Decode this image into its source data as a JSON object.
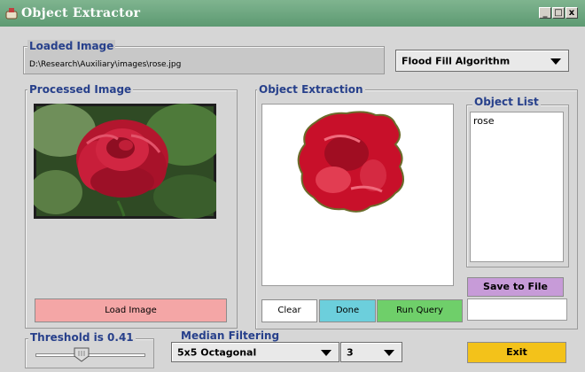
{
  "window": {
    "title": "Object Extractor",
    "controls": {
      "minimize": "_",
      "maximize": "□",
      "close": "x"
    }
  },
  "loaded_image": {
    "label": "Loaded Image",
    "path": "D:\\Research\\Auxiliary\\images\\rose.jpg"
  },
  "algorithm": {
    "selected": "Flood Fill Algorithm"
  },
  "processed_image": {
    "label": "Processed Image",
    "load_button": "Load Image"
  },
  "object_extraction": {
    "label": "Object Extraction",
    "clear_button": "Clear",
    "done_button": "Done",
    "run_query_button": "Run Query"
  },
  "object_list": {
    "label": "Object List",
    "items": [
      "rose"
    ],
    "save_button": "Save to File"
  },
  "threshold": {
    "label": "Threshold is 0.41",
    "value": 0.41
  },
  "median_filtering": {
    "label": "Median Filtering",
    "shape_selected": "5x5 Octagonal",
    "size_selected": "3"
  },
  "exit_button": "Exit",
  "colors": {
    "title_bar": "#66a07a",
    "group_label": "#27408b",
    "load_button": "#f4a6a6",
    "done_button": "#6ccfdc",
    "run_query_button": "#6fcf6a",
    "save_button": "#c79bd8",
    "exit_button": "#f3c21a"
  }
}
